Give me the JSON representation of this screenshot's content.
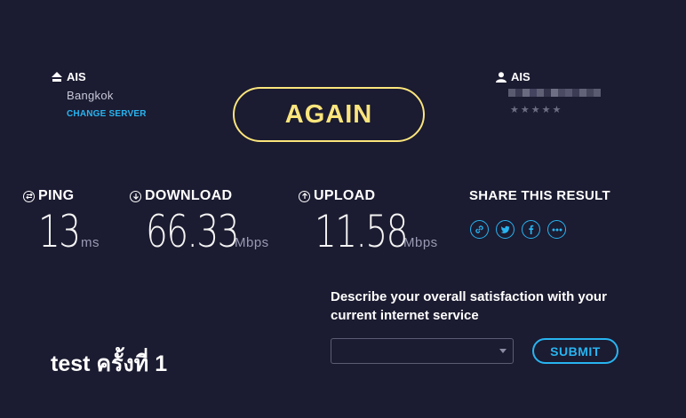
{
  "server": {
    "isp": "AIS",
    "city": "Bangkok",
    "change_label": "CHANGE SERVER"
  },
  "again_label": "AGAIN",
  "client": {
    "isp": "AIS",
    "stars": "★★★★★"
  },
  "metrics": {
    "ping": {
      "label": "PING",
      "value": "13",
      "unit": "ms"
    },
    "download": {
      "label": "DOWNLOAD",
      "value": "66.33",
      "unit": "Mbps"
    },
    "upload": {
      "label": "UPLOAD",
      "value": "11.58",
      "unit": "Mbps"
    }
  },
  "share": {
    "title": "SHARE THIS RESULT",
    "icons": [
      "link-icon",
      "twitter-icon",
      "facebook-icon",
      "more-icon"
    ]
  },
  "survey": {
    "question": "Describe your overall satisfaction with your current internet service",
    "selected": "",
    "submit_label": "SUBMIT"
  },
  "caption": "test ครั้งที่ 1",
  "colors": {
    "background": "#1b1b31",
    "accent_yellow": "#fbe57c",
    "accent_blue": "#28b4f0"
  }
}
